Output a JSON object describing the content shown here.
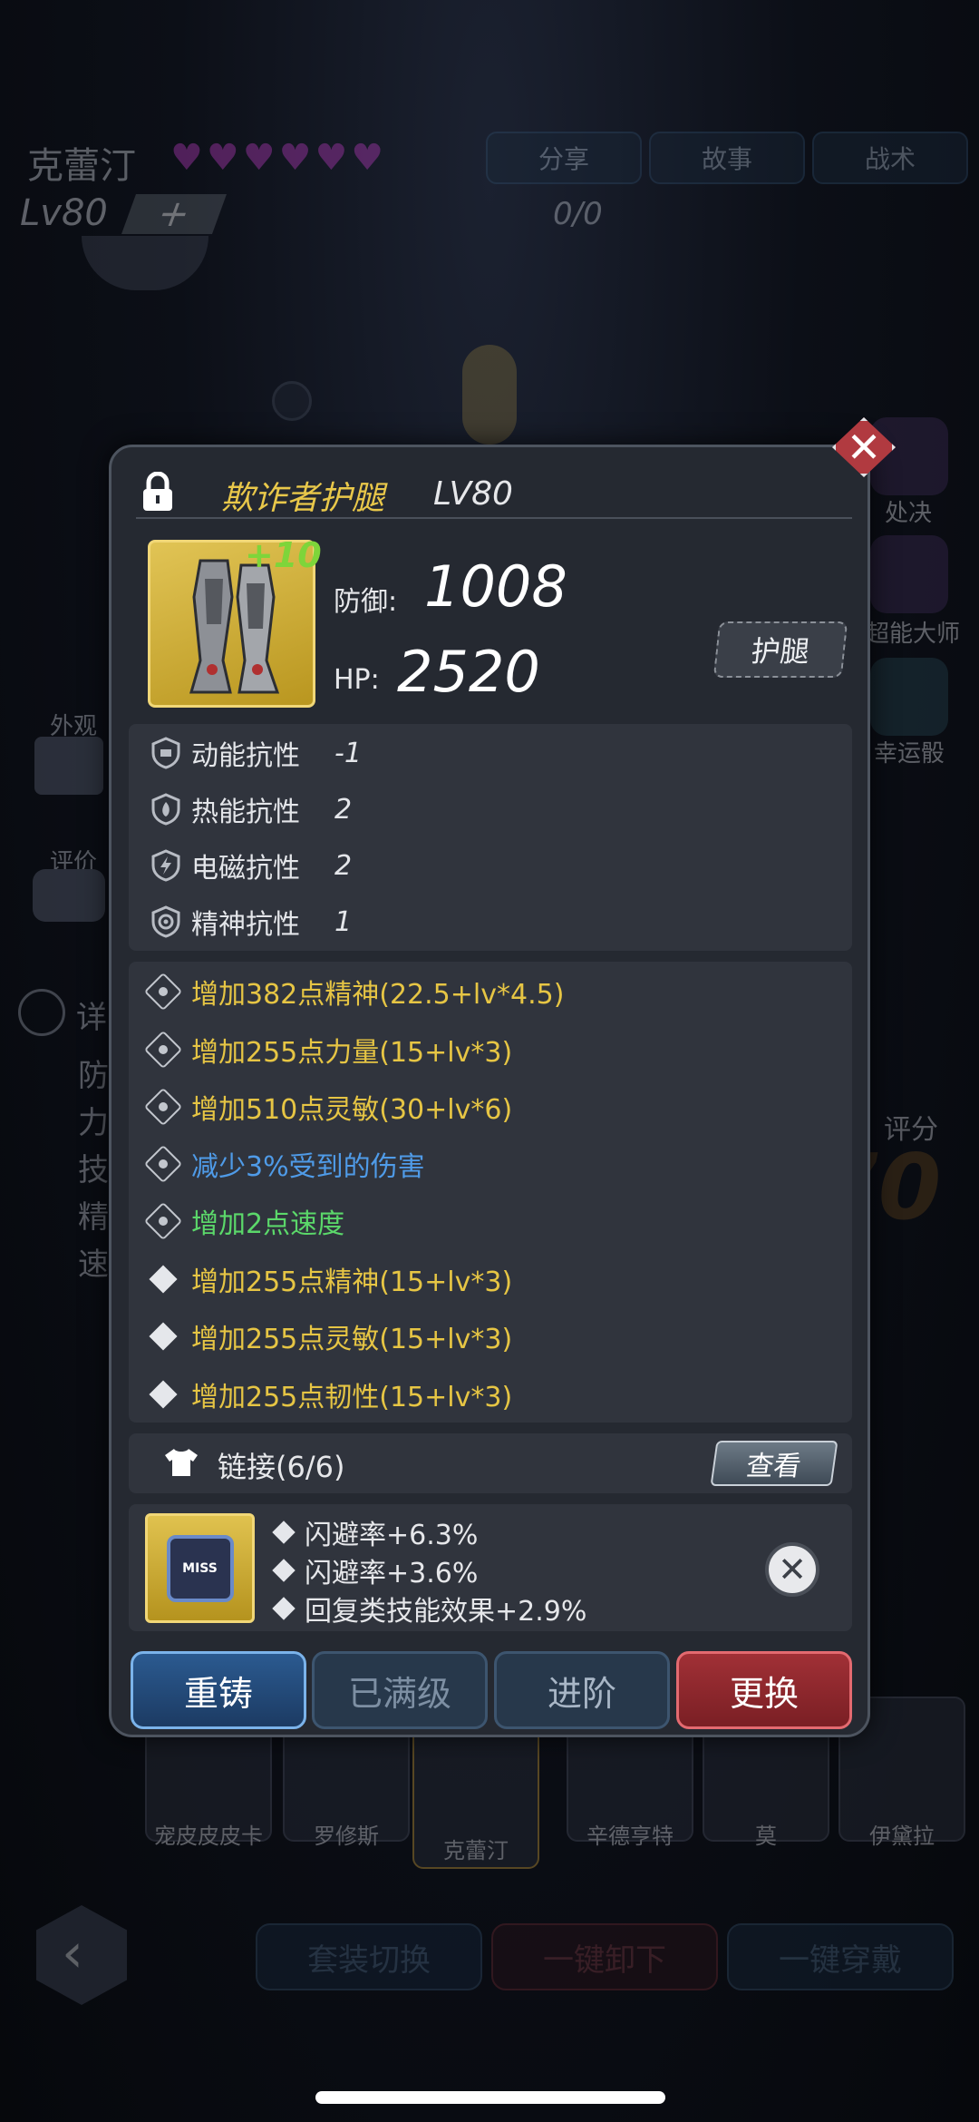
{
  "header": {
    "character_name": "克蕾汀",
    "hearts": 6,
    "tabs": [
      "分享",
      "故事",
      "战术"
    ],
    "level": "Lv80",
    "plus": "+",
    "count": "0/0"
  },
  "left_side": {
    "appearance": "外观",
    "review": "评价",
    "detail": "详",
    "stats": [
      "防",
      "力",
      "技",
      "精",
      "速"
    ]
  },
  "right_side": {
    "items": [
      "处决",
      "超能大师",
      "幸运骰"
    ],
    "score_label": "评分",
    "score_value": "5970 7"
  },
  "bottom": {
    "portraits": [
      "宠皮皮皮卡",
      "罗修斯",
      "克蕾汀",
      "辛德亨特",
      "莫",
      "伊黛拉"
    ],
    "buttons": [
      "套装切换",
      "一键卸下",
      "一键穿戴"
    ]
  },
  "dialog": {
    "close": "✕",
    "item_name": "欺诈者护腿",
    "item_level": "LV80",
    "enhance": "+10",
    "defense_label": "防御:",
    "defense_value": "1008",
    "hp_label": "HP:",
    "hp_value": "2520",
    "slot": "护腿",
    "resistances": [
      {
        "name": "动能抗性",
        "value": "-1"
      },
      {
        "name": "热能抗性",
        "value": "2"
      },
      {
        "name": "电磁抗性",
        "value": "2"
      },
      {
        "name": "精神抗性",
        "value": "1"
      }
    ],
    "attributes": [
      {
        "text": "增加382点精神(22.5+lv*4.5)",
        "color": "#e6c544",
        "bullet": "gear"
      },
      {
        "text": "增加255点力量(15+lv*3)",
        "color": "#e6c544",
        "bullet": "gear"
      },
      {
        "text": "增加510点灵敏(30+lv*6)",
        "color": "#e6c544",
        "bullet": "gear"
      },
      {
        "text": "减少3%受到的伤害",
        "color": "#4f9be8",
        "bullet": "gear"
      },
      {
        "text": "增加2点速度",
        "color": "#5bd86a",
        "bullet": "gear"
      },
      {
        "text": "增加255点精神(15+lv*3)",
        "color": "#e6c544",
        "bullet": "diamond"
      },
      {
        "text": "增加255点灵敏(15+lv*3)",
        "color": "#e6c544",
        "bullet": "diamond"
      },
      {
        "text": "增加255点韧性(15+lv*3)",
        "color": "#e6c544",
        "bullet": "diamond"
      }
    ],
    "link_label": "链接(6/6)",
    "view_button": "查看",
    "chip_text": "MISS",
    "chip_bonuses": [
      "闪避率+6.3%",
      "闪避率+3.6%",
      "回复类技能效果+2.9%"
    ],
    "actions": {
      "recast": "重铸",
      "maxed": "已满级",
      "advance": "进阶",
      "replace": "更换"
    }
  }
}
